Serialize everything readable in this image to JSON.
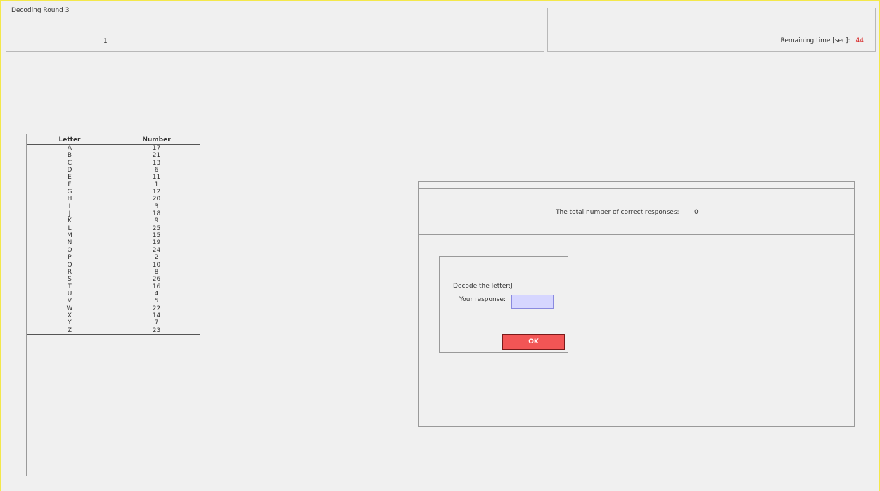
{
  "round": {
    "legend": "Decoding Round 3",
    "number": "1"
  },
  "timer": {
    "label": "Remaining time [sec]:",
    "value": "44"
  },
  "code_table": {
    "headers": [
      "Letter",
      "Number"
    ],
    "rows": [
      [
        "A",
        "17"
      ],
      [
        "B",
        "21"
      ],
      [
        "C",
        "13"
      ],
      [
        "D",
        "6"
      ],
      [
        "E",
        "11"
      ],
      [
        "F",
        "1"
      ],
      [
        "G",
        "12"
      ],
      [
        "H",
        "20"
      ],
      [
        "I",
        "3"
      ],
      [
        "J",
        "18"
      ],
      [
        "K",
        "9"
      ],
      [
        "L",
        "25"
      ],
      [
        "M",
        "15"
      ],
      [
        "N",
        "19"
      ],
      [
        "O",
        "24"
      ],
      [
        "P",
        "2"
      ],
      [
        "Q",
        "10"
      ],
      [
        "R",
        "8"
      ],
      [
        "S",
        "26"
      ],
      [
        "T",
        "16"
      ],
      [
        "U",
        "4"
      ],
      [
        "V",
        "5"
      ],
      [
        "W",
        "22"
      ],
      [
        "X",
        "14"
      ],
      [
        "Y",
        "7"
      ],
      [
        "Z",
        "23"
      ]
    ]
  },
  "results": {
    "correct_label": "The total number of correct responses:",
    "correct_value": "0"
  },
  "decode": {
    "prompt_label": "Decode the letter:",
    "letter": "J",
    "response_label": "Your response:",
    "response_value": "",
    "ok_label": "OK"
  },
  "colors": {
    "frame": "#f4e84a",
    "timer_value": "#d62020",
    "ok_button": "#f25555",
    "input_bg": "#d6d6ff"
  }
}
